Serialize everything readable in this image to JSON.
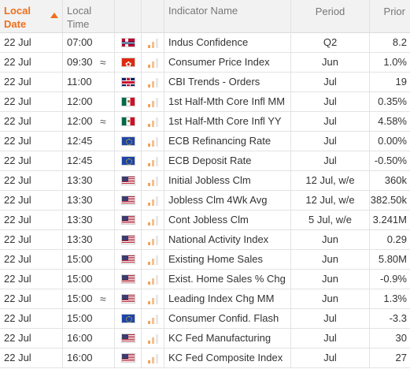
{
  "header": {
    "date_label_line1": "Local",
    "date_label_line2": "Date",
    "time_label_line1": "Local",
    "time_label_line2": "Time",
    "indicator_label": "Indicator Name",
    "period_label": "Period",
    "prior_label": "Prior"
  },
  "colors": {
    "accent": "#ee6f1d",
    "header_bg": "#f2f2f2",
    "impact_bar": "#f5c08e"
  },
  "rows": [
    {
      "date": "22 Jul",
      "time": "07:00",
      "approx": "",
      "flag": "norway-flag-icon",
      "indicator": "Indus Confidence",
      "period": "Q2",
      "prior": "8.2"
    },
    {
      "date": "22 Jul",
      "time": "09:30",
      "approx": "≈",
      "flag": "hong-kong-flag-icon",
      "indicator": "Consumer Price Index",
      "period": "Jun",
      "prior": "1.0%"
    },
    {
      "date": "22 Jul",
      "time": "11:00",
      "approx": "",
      "flag": "uk-flag-icon",
      "indicator": "CBI Trends - Orders",
      "period": "Jul",
      "prior": "19"
    },
    {
      "date": "22 Jul",
      "time": "12:00",
      "approx": "",
      "flag": "mexico-flag-icon",
      "indicator": "1st Half-Mth Core Infl MM",
      "period": "Jul",
      "prior": "0.35%"
    },
    {
      "date": "22 Jul",
      "time": "12:00",
      "approx": "≈",
      "flag": "mexico-flag-icon",
      "indicator": "1st Half-Mth Core Infl YY",
      "period": "Jul",
      "prior": "4.58%"
    },
    {
      "date": "22 Jul",
      "time": "12:45",
      "approx": "",
      "flag": "eu-flag-icon",
      "indicator": "ECB Refinancing Rate",
      "period": "Jul",
      "prior": "0.00%"
    },
    {
      "date": "22 Jul",
      "time": "12:45",
      "approx": "",
      "flag": "eu-flag-icon",
      "indicator": "ECB Deposit Rate",
      "period": "Jul",
      "prior": "-0.50%"
    },
    {
      "date": "22 Jul",
      "time": "13:30",
      "approx": "",
      "flag": "us-flag-icon",
      "indicator": "Initial Jobless Clm",
      "period": "12 Jul, w/e",
      "prior": "360k"
    },
    {
      "date": "22 Jul",
      "time": "13:30",
      "approx": "",
      "flag": "us-flag-icon",
      "indicator": "Jobless Clm 4Wk Avg",
      "period": "12 Jul, w/e",
      "prior": "382.50k"
    },
    {
      "date": "22 Jul",
      "time": "13:30",
      "approx": "",
      "flag": "us-flag-icon",
      "indicator": "Cont Jobless Clm",
      "period": "5 Jul, w/e",
      "prior": "3.241M"
    },
    {
      "date": "22 Jul",
      "time": "13:30",
      "approx": "",
      "flag": "us-flag-icon",
      "indicator": "National Activity Index",
      "period": "Jun",
      "prior": "0.29"
    },
    {
      "date": "22 Jul",
      "time": "15:00",
      "approx": "",
      "flag": "us-flag-icon",
      "indicator": "Existing Home Sales",
      "period": "Jun",
      "prior": "5.80M"
    },
    {
      "date": "22 Jul",
      "time": "15:00",
      "approx": "",
      "flag": "us-flag-icon",
      "indicator": "Exist. Home Sales % Chg",
      "period": "Jun",
      "prior": "-0.9%"
    },
    {
      "date": "22 Jul",
      "time": "15:00",
      "approx": "≈",
      "flag": "us-flag-icon",
      "indicator": "Leading Index Chg MM",
      "period": "Jun",
      "prior": "1.3%"
    },
    {
      "date": "22 Jul",
      "time": "15:00",
      "approx": "",
      "flag": "eu-flag-icon",
      "indicator": "Consumer Confid. Flash",
      "period": "Jul",
      "prior": "-3.3"
    },
    {
      "date": "22 Jul",
      "time": "16:00",
      "approx": "",
      "flag": "us-flag-icon",
      "indicator": "KC Fed Manufacturing",
      "period": "Jul",
      "prior": "30"
    },
    {
      "date": "22 Jul",
      "time": "16:00",
      "approx": "",
      "flag": "us-flag-icon",
      "indicator": "KC Fed Composite Index",
      "period": "Jul",
      "prior": "27"
    }
  ]
}
